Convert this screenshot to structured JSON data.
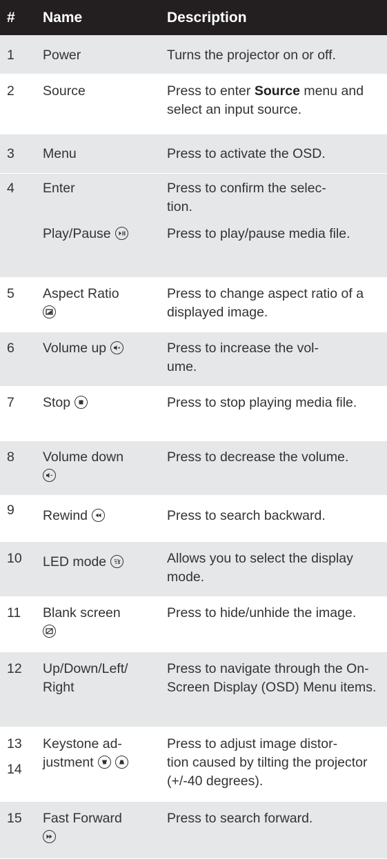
{
  "header": {
    "num": "#",
    "name": "Name",
    "description": "Description"
  },
  "rows": [
    {
      "num": "1",
      "name": "Power",
      "desc": "Turns the projector on or off."
    },
    {
      "num": "2",
      "name": "Source",
      "desc_pre": "Press to enter ",
      "desc_bold": "Source",
      "desc_post": " menu and select an input source."
    },
    {
      "num": "3",
      "name": "Menu",
      "desc": "Press to activate the OSD."
    },
    {
      "num": "4",
      "name": "Enter",
      "desc": "Press to confirm the selec-tion."
    },
    {
      "num": "",
      "name": "Play/Pause",
      "icon": "play-pause-icon",
      "desc": "Press to play/pause media file."
    },
    {
      "num": "5",
      "name": "Aspect Ratio",
      "icon": "aspect-ratio-icon",
      "desc": "Press to change aspect ratio of a displayed image."
    },
    {
      "num": "6",
      "name": "Volume up",
      "icon": "volume-up-icon",
      "desc": "Press to increase the vol-ume."
    },
    {
      "num": "7",
      "name": "Stop",
      "icon": "stop-icon",
      "desc": "Press to stop playing media file."
    },
    {
      "num": "8",
      "name": "Volume down",
      "icon": "volume-down-icon",
      "desc": "Press to decrease the volume."
    },
    {
      "num": "9",
      "name": "Rewind",
      "icon": "rewind-icon",
      "desc": "Press to search backward."
    },
    {
      "num": "10",
      "name": "LED mode",
      "icon": "led-mode-icon",
      "desc": "Allows you to select the display mode."
    },
    {
      "num": "11",
      "name": "Blank screen",
      "icon": "blank-screen-icon",
      "desc": "Press to hide/unhide the image."
    },
    {
      "num": "12",
      "name": "Up/Down/Left/Right",
      "desc": "Press to navigate through the On-Screen Display (OSD) Menu items."
    },
    {
      "num": "13",
      "num2": "14",
      "name": "Keystone ad-justment",
      "icon": "keystone-icon",
      "desc": "Press to adjust image distor-tion caused by tilting the projector (+/-40 degrees)."
    },
    {
      "num": "15",
      "name": "Fast Forward",
      "icon": "fast-forward-icon",
      "desc": "Press to search forward."
    }
  ]
}
